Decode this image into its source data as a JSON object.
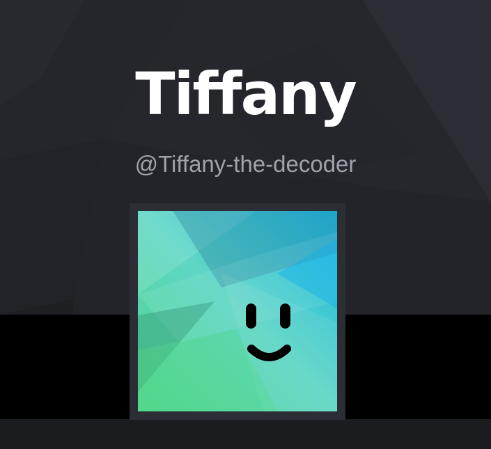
{
  "profile": {
    "display_name": "Tiffany",
    "username": "@Tiffany-the-decoder"
  },
  "avatar": {
    "icon": "smiley-face-icon",
    "gradient_colors": [
      "#4fd68a",
      "#5fd6c4",
      "#1ab8e4"
    ]
  },
  "colors": {
    "hero_background": "#1e1f23",
    "band": "#000000",
    "footer": "#1b1c20",
    "frame": "#2c2e35",
    "display_name": "#ffffff",
    "username": "#a2a2ad"
  }
}
